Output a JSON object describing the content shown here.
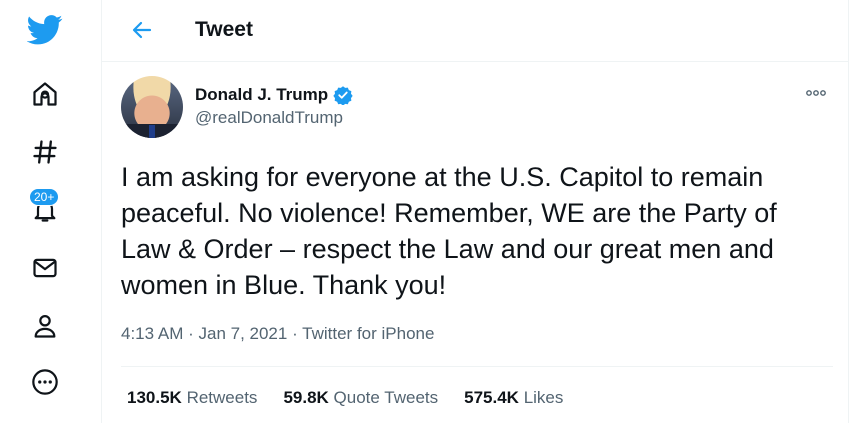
{
  "colors": {
    "brand": "#1d9bf0",
    "text_primary": "#0f1419",
    "text_secondary": "#536471",
    "verified": "#1d9bf0"
  },
  "nav": {
    "logo_icon": "twitter-bird-icon",
    "items": [
      {
        "id": "home",
        "icon": "home-icon"
      },
      {
        "id": "explore",
        "icon": "hashtag-icon"
      },
      {
        "id": "notifications",
        "icon": "bell-icon",
        "badge": "20+"
      },
      {
        "id": "messages",
        "icon": "envelope-icon"
      },
      {
        "id": "profile",
        "icon": "person-icon"
      },
      {
        "id": "more",
        "icon": "more-circle-icon"
      }
    ]
  },
  "header": {
    "back_icon": "arrow-left-icon",
    "title": "Tweet"
  },
  "tweet": {
    "author": {
      "display_name": "Donald J. Trump",
      "handle": "@realDonaldTrump",
      "verified": true
    },
    "text": "I am asking for everyone at the U.S. Capitol to remain peaceful. No violence! Remember, WE are the Party of Law & Order – respect the Law and our great men and women in Blue. Thank you!",
    "time": "4:13 AM",
    "separator": " · ",
    "date": "Jan 7, 2021",
    "source": "Twitter for iPhone",
    "stats": [
      {
        "value": "130.5K",
        "label": "Retweets"
      },
      {
        "value": "59.8K",
        "label": "Quote Tweets"
      },
      {
        "value": "575.4K",
        "label": "Likes"
      }
    ]
  }
}
